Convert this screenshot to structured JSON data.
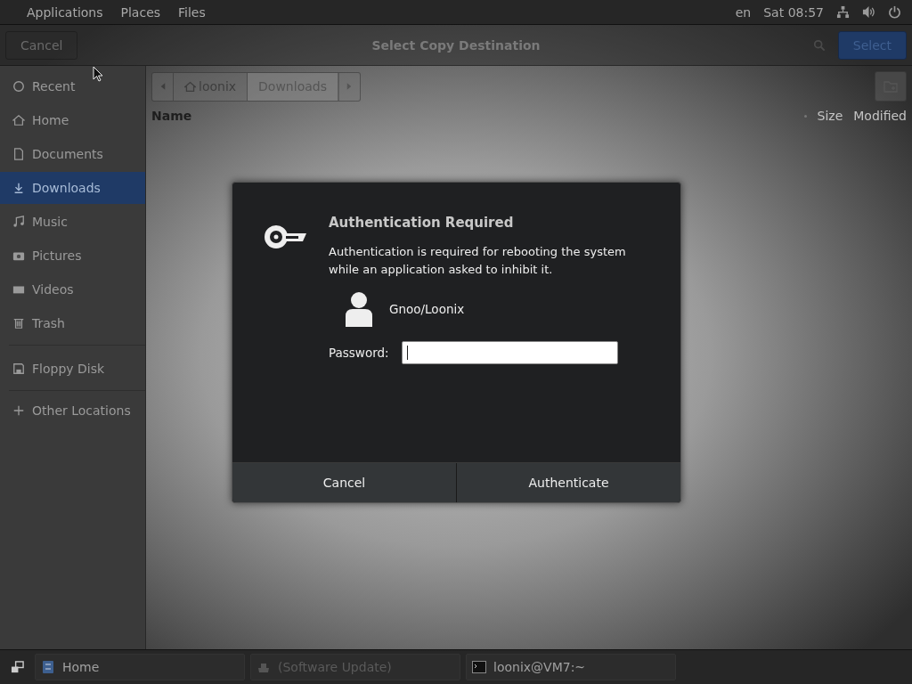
{
  "top_bar": {
    "menus": [
      "Applications",
      "Places",
      "Files"
    ],
    "keyboard": "en",
    "clock": "Sat 08:57"
  },
  "file_chooser": {
    "cancel": "Cancel",
    "title": "Select Copy Destination",
    "select": "Select",
    "sidebar": [
      {
        "label": "Recent",
        "selected": false
      },
      {
        "label": "Home",
        "selected": false
      },
      {
        "label": "Documents",
        "selected": false
      },
      {
        "label": "Downloads",
        "selected": true
      },
      {
        "label": "Music",
        "selected": false
      },
      {
        "label": "Pictures",
        "selected": false
      },
      {
        "label": "Videos",
        "selected": false
      },
      {
        "label": "Trash",
        "selected": false
      },
      {
        "label": "Floppy Disk",
        "selected": false
      },
      {
        "label": "Other Locations",
        "selected": false
      }
    ],
    "path": [
      {
        "label": "loonix",
        "selected": false
      },
      {
        "label": "Downloads",
        "selected": true
      }
    ],
    "columns": [
      "Name",
      "Size",
      "Modified"
    ]
  },
  "dialog": {
    "title": "Authentication Required",
    "message": "Authentication is required for rebooting the system while an application asked to inhibit it.",
    "user": "Gnoo/Loonix",
    "password_label": "Password:",
    "buttons": [
      "Cancel",
      "Authenticate"
    ]
  },
  "taskbar": [
    {
      "label": "Home",
      "disabled": false
    },
    {
      "label": "(Software Update)",
      "disabled": true
    },
    {
      "label": "loonix@VM7:~",
      "disabled": false
    }
  ]
}
